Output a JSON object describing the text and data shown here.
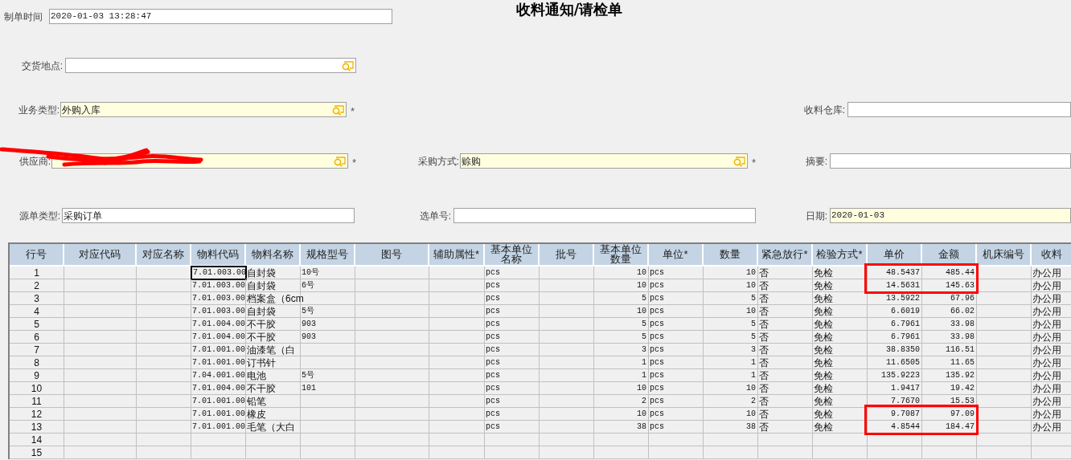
{
  "title": "收料通知/请检单",
  "form_rows": [
    [
      {
        "label": "制单时间",
        "value": "2020-01-03 13:28:47",
        "highlighted": false
      },
      null,
      null
    ],
    [
      {
        "label": "交货地点:",
        "lookup": true,
        "highlighted": false
      },
      null,
      null
    ],
    [
      {
        "label": "业务类型:",
        "value": "外购入库",
        "lookup": true,
        "required_mark": "*",
        "highlighted": true
      },
      null,
      {
        "label": "收料仓库:",
        "highlighted": false
      }
    ],
    [
      {
        "label": "供应商:",
        "lookup": true,
        "required_mark": "*",
        "highlighted": true,
        "redacted": true
      },
      {
        "label": "采购方式:",
        "value": "赊购",
        "lookup": true,
        "required_mark": "*",
        "highlighted": true
      },
      {
        "label": "摘要:",
        "highlighted": false
      }
    ],
    [
      {
        "label": "源单类型:",
        "value": "采购订单",
        "highlighted": false
      },
      {
        "label": "选单号:",
        "highlighted": false
      },
      {
        "label": "日期:",
        "value": "2020-01-03",
        "highlighted": true
      }
    ]
  ],
  "table": {
    "columns": [
      "行号",
      "对应代码",
      "对应名称",
      "物料代码",
      "物料名称",
      "规格型号",
      "图号",
      "辅助属性*",
      "基本单位名称",
      "批号",
      "基本单位数量",
      "单位*",
      "数量",
      "紧急放行*",
      "检验方式*",
      "单价",
      "金额",
      "机床编号",
      "收料"
    ],
    "rows": [
      {
        "selected": true,
        "marked": true,
        "cells": [
          "1",
          null,
          null,
          "7.01.003.00",
          "自封袋",
          "10号",
          null,
          null,
          "pcs",
          null,
          "10",
          "pcs",
          "10",
          "否",
          "免检",
          "48.5437",
          "485.44",
          null,
          "办公用"
        ]
      },
      {
        "selected": false,
        "marked": true,
        "cells": [
          "2",
          null,
          null,
          "7.01.003.00",
          "自封袋",
          "6号",
          null,
          null,
          "pcs",
          null,
          "10",
          "pcs",
          "10",
          "否",
          "免检",
          "14.5631",
          "145.63",
          null,
          "办公用"
        ]
      },
      {
        "selected": false,
        "marked": false,
        "cells": [
          "3",
          null,
          null,
          "7.01.003.00",
          "档案盒（6cm",
          null,
          null,
          null,
          "pcs",
          null,
          "5",
          "pcs",
          "5",
          "否",
          "免检",
          "13.5922",
          "67.96",
          null,
          "办公用"
        ]
      },
      {
        "selected": false,
        "marked": false,
        "cells": [
          "4",
          null,
          null,
          "7.01.003.00",
          "自封袋",
          "5号",
          null,
          null,
          "pcs",
          null,
          "10",
          "pcs",
          "10",
          "否",
          "免检",
          "6.6019",
          "66.02",
          null,
          "办公用"
        ]
      },
      {
        "selected": false,
        "marked": false,
        "cells": [
          "5",
          null,
          null,
          "7.01.004.00",
          "不干胶",
          "903",
          null,
          null,
          "pcs",
          null,
          "5",
          "pcs",
          "5",
          "否",
          "免检",
          "6.7961",
          "33.98",
          null,
          "办公用"
        ]
      },
      {
        "selected": false,
        "marked": false,
        "cells": [
          "6",
          null,
          null,
          "7.01.004.00",
          "不干胶",
          "903",
          null,
          null,
          "pcs",
          null,
          "5",
          "pcs",
          "5",
          "否",
          "免检",
          "6.7961",
          "33.98",
          null,
          "办公用"
        ]
      },
      {
        "selected": false,
        "marked": false,
        "cells": [
          "7",
          null,
          null,
          "7.01.001.00",
          "油漆笔（白",
          null,
          null,
          null,
          "pcs",
          null,
          "3",
          "pcs",
          "3",
          "否",
          "免检",
          "38.8350",
          "116.51",
          null,
          "办公用"
        ]
      },
      {
        "selected": false,
        "marked": false,
        "cells": [
          "8",
          null,
          null,
          "7.01.001.00",
          "订书针",
          null,
          null,
          null,
          "pcs",
          null,
          "1",
          "pcs",
          "1",
          "否",
          "免检",
          "11.6505",
          "11.65",
          null,
          "办公用"
        ]
      },
      {
        "selected": false,
        "marked": false,
        "cells": [
          "9",
          null,
          null,
          "7.04.001.00",
          "电池",
          "5号",
          null,
          null,
          "pcs",
          null,
          "1",
          "pcs",
          "1",
          "否",
          "免检",
          "135.9223",
          "135.92",
          null,
          "办公用"
        ]
      },
      {
        "selected": false,
        "marked": false,
        "cells": [
          "10",
          null,
          null,
          "7.01.004.00",
          "不干胶",
          "101",
          null,
          null,
          "pcs",
          null,
          "10",
          "pcs",
          "10",
          "否",
          "免检",
          "1.9417",
          "19.42",
          null,
          "办公用"
        ]
      },
      {
        "selected": false,
        "marked": false,
        "cells": [
          "11",
          null,
          null,
          "7.01.001.00",
          "铅笔",
          null,
          null,
          null,
          "pcs",
          null,
          "2",
          "pcs",
          "2",
          "否",
          "免检",
          "7.7670",
          "15.53",
          null,
          "办公用"
        ]
      },
      {
        "selected": false,
        "marked": true,
        "cells": [
          "12",
          null,
          null,
          "7.01.001.00",
          "橡皮",
          null,
          null,
          null,
          "pcs",
          null,
          "10",
          "pcs",
          "10",
          "否",
          "免检",
          "9.7087",
          "97.09",
          null,
          "办公用"
        ]
      },
      {
        "selected": false,
        "marked": true,
        "cells": [
          "13",
          null,
          null,
          "7.01.001.00",
          "毛笔（大白",
          null,
          null,
          null,
          "pcs",
          null,
          "38",
          "pcs",
          "38",
          "否",
          "免检",
          "4.8544",
          "184.47",
          null,
          "办公用"
        ]
      },
      {
        "selected": false,
        "marked": false,
        "cells": [
          "14"
        ]
      },
      {
        "selected": false,
        "marked": false,
        "cells": [
          "15"
        ]
      }
    ]
  }
}
